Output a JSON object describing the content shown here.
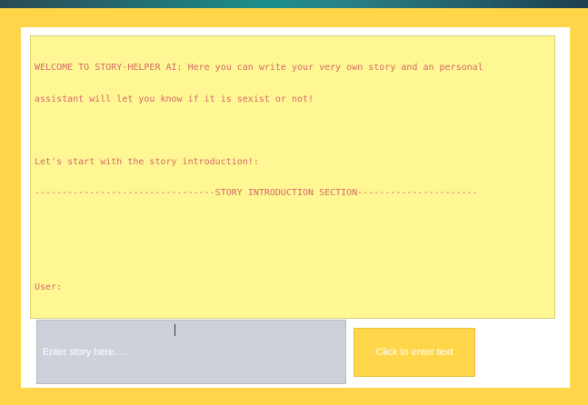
{
  "story_log": {
    "welcome_line_1": "WELCOME TO STORY-HELPER AI: Here you can write your very own story and an personal",
    "welcome_line_2": "assistant will let you know if it is sexist or not!",
    "prompt_line": "Let's start with the story introduction!:",
    "section_divider": "---------------------------------STORY INTRODUCTION SECTION----------------------",
    "user_label": "User:"
  },
  "story_input": {
    "placeholder": "Enter story here.....",
    "value": ""
  },
  "enter_button": {
    "label": "Click to enter text"
  },
  "colors": {
    "frame": "#ffd64a",
    "log_background": "#fef793",
    "log_text": "#d66a6a",
    "input_background": "#cfd1da"
  }
}
